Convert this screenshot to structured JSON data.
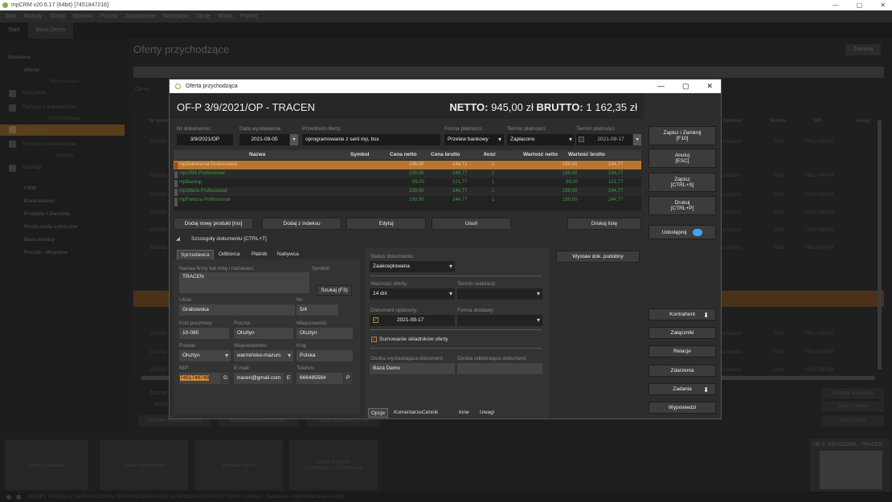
{
  "window": {
    "title": "mpCRM v20.6.17 (64bit) [7451847216]",
    "min": "—",
    "max": "▢",
    "close": "✕"
  },
  "menubar": [
    "Start",
    "Moduły",
    "Skróty",
    "Słowniki",
    "Poczta",
    "Zarządzanie",
    "Narzędzia",
    "Opcje",
    "Widok",
    "Pomoc"
  ],
  "tabs": [
    "Start",
    "Baza Demo"
  ],
  "sidebar": {
    "sections": [
      "Słubiono",
      "Oferty"
    ],
    "cat_wychodzace": "Wychodzące",
    "wych_items": [
      "Wszystkie",
      "Pozycje z dokumentów"
    ],
    "cat_przychodzace": "Przychodzące",
    "przych_items": [
      "Wszystkie",
      "Pozycje z dokumentów"
    ],
    "cat_katalog": "Katalog",
    "katalog_items": [
      "Katalogi"
    ],
    "modules": [
      "CRM",
      "Kontrahenci",
      "Projekty i Zlecenia",
      "Rozliczenia cykliczne",
      "Baza wiedzy",
      "Poczta - Wspólne"
    ]
  },
  "main": {
    "title": "Oferty przychodzące",
    "close_label": "Zamknij",
    "filter_label": "Okres",
    "headers": [
      "Nr doku",
      "Symbol",
      "Waluta",
      "NIP",
      "Uwagi"
    ],
    "rows": [
      {
        "date": "3/1/202",
        "contr": "za Demo",
        "cur": "PLN",
        "nip": "7451749749"
      },
      {
        "date": "5/10/20",
        "contr": "za Demo",
        "cur": "PLN",
        "nip": "7451749749"
      },
      {
        "date": "5/10/20",
        "contr": "za Demo",
        "cur": "PLN",
        "nip": "7451749749"
      },
      {
        "date": "7/5/202",
        "contr": "za Demo",
        "cur": "PLN",
        "nip": "7451749749"
      },
      {
        "date": "6/5/202",
        "contr": "za Demo",
        "cur": "PLN",
        "nip": "7451749749"
      },
      {
        "date": "3/9/202",
        "contr": "za Demo",
        "cur": "PLN",
        "nip": "7451749749"
      },
      {
        "date": "1/6/202",
        "contr": "za Demo",
        "cur": "PLN",
        "nip": "7451749749"
      },
      {
        "date": "1/3/202",
        "contr": "za Demo",
        "cur": "PLN",
        "nip": "7451749749"
      },
      {
        "date": "1/3/202",
        "contr": "za Demo",
        "cur": "PLN",
        "nip": "7451749749"
      }
    ],
    "bottom_left": [
      "Zaznacz",
      "Wszy"
    ],
    "bottom_buttons": [
      "Wystaw dokument (Ins)",
      "Edytuj dokument (Enter)",
      "Usuń dokument (Del)"
    ],
    "right_buttons": [
      "Wczytaj wszystkie",
      "Zapisz tabelę",
      "Drukuj listę"
    ]
  },
  "bottom_tiles": [
    "Utwórz zadanie",
    "Dodaj kontrahenta",
    "Wystaw ofertę",
    "Dodaj przypisz\nSzybkiego uruchamiania"
  ],
  "preview_title": "OF-P 3/9/2021/OP - TRACEN",
  "statusbar": "INSOFT SPÓŁKA Z OGRANICZONĄ ODPOWIEDZIALNOŚCIĄ SPÓŁKA KOMANDYTOWA \\ Olsztyn - Database: mpbridbazaDemoczBa",
  "dialog": {
    "title": "Oferta przychodząca",
    "doc_title": "OF-P 3/9/2021/OP - TRACEN",
    "netto_label": "NETTO:",
    "netto_value": "945,00 zł",
    "brutto_label": "BRUTTO:",
    "brutto_value": "1 162,35 zł",
    "labels": {
      "nr": "Nr dokumentu:",
      "data": "Data wystawienia:",
      "przedmiot": "Przedmiot oferty:",
      "forma": "Forma płatności:",
      "termin1": "Termin płatności:",
      "termin2": "Termin płatności:"
    },
    "values": {
      "nr": "3/9/2021/OP",
      "data": "2021-09-05",
      "przedmiot": "oprogramowanie z serii mp, bsx",
      "forma": "Przelew bankowy",
      "termin1": "Zapłacono",
      "termin2": "2021-09-17"
    },
    "table_headers": [
      "Nazwa",
      "Symbol",
      "Cena netto",
      "Cena brutto",
      "Ilość",
      "Wartość netto",
      "Wartość brutto"
    ],
    "products": [
      {
        "name": "mpSekretariat Professional",
        "netto": "198,00",
        "brutto": "244,71",
        "qty": "1",
        "wnetto": "199,00",
        "wbrutto": "244,77"
      },
      {
        "name": "mpCRM Professional",
        "netto": "199,00",
        "brutto": "244,77",
        "qty": "1",
        "wnetto": "199,00",
        "wbrutto": "244,77"
      },
      {
        "name": "mpBackup",
        "netto": "99,00",
        "brutto": "121,77",
        "qty": "1",
        "wnetto": "99,00",
        "wbrutto": "121,77"
      },
      {
        "name": "mpOferta Professional",
        "netto": "199,00",
        "brutto": "244,77",
        "qty": "1",
        "wnetto": "199,00",
        "wbrutto": "244,77"
      },
      {
        "name": "mpFaktura Professional",
        "netto": "199,00",
        "brutto": "244,77",
        "qty": "1",
        "wnetto": "199,00",
        "wbrutto": "244,77"
      }
    ],
    "table_buttons": [
      "Dodaj nowy produkt [Ins]",
      "Dodaj z indeksu",
      "Edytuj",
      "Usuń",
      "Drukuj listę"
    ],
    "details_toggle": "Szczegóły dokumentu [CTRL+T]",
    "party_tabs": [
      "Sprzedawca",
      "Odbiorca",
      "Płatnik",
      "Nabywca"
    ],
    "seller": {
      "name_label": "Nazwa firmy lub imię i nazwisko:",
      "name": "TRACEN",
      "symbol_label": "Symbol:",
      "search_btn": "Szukaj (F3)",
      "street_label": "Ulica:",
      "street": "Grabowska",
      "nr_label": "Nr:",
      "nr": "5/4",
      "postal_label": "Kod pocztowy:",
      "postal": "10-085",
      "post_label": "Poczta:",
      "post": "Olsztyn",
      "city_label": "Miejscowość:",
      "city": "Olsztyn",
      "county_label": "Powiat:",
      "county": "Olsztyn",
      "voiv_label": "Województwo:",
      "voiv": "warmińsko-mazurs",
      "country_label": "Kraj:",
      "country": "Polska",
      "nip_label": "NIP:",
      "nip": "7451749749",
      "nip_btn": "G",
      "email_label": "E-mail:",
      "email": "tracen@gmail.com",
      "email_btn": "E",
      "phone_label": "Telefon:",
      "phone": "666485584",
      "phone_btn": "P"
    },
    "status": {
      "status_label": "Status dokumentu:",
      "status": "Zaakceptowana",
      "validity_label": "Ważność oferty:",
      "validity": "14 dni",
      "realization_label": "Termin realizacji:",
      "paid_label": "Dokument opłacony:",
      "paid_date": "2021-09-17",
      "delivery_label": "Forma dostawy:",
      "sum_label": "Sumowanie składników oferty",
      "issuer_label": "Osoba wystawiająca dokument:",
      "issuer": "Baza Demo",
      "receiver_label": "Osoba odbierająca dokument:"
    },
    "similar_btn": "Wystaw dok. podobny",
    "bottom_tabs": [
      "Opcje",
      "Komentarze",
      "Cennik",
      "Inne",
      "Uwagi"
    ],
    "right_buttons": [
      {
        "l1": "Zapisz i Zamknij",
        "l2": "[F10]"
      },
      {
        "l1": "Anuluj",
        "l2": "[ESC]"
      },
      {
        "l1": "Zapisz",
        "l2": "[CTRL+S]"
      },
      {
        "l1": "Drukuj",
        "l2": "[CTRL+P]"
      }
    ],
    "share_btn": "Udostępnij",
    "side_buttons": [
      "Kontrahent",
      "Załączniki",
      "Relacje",
      "Zdarzenia",
      "Zadania",
      "Wypowiedzi"
    ]
  }
}
